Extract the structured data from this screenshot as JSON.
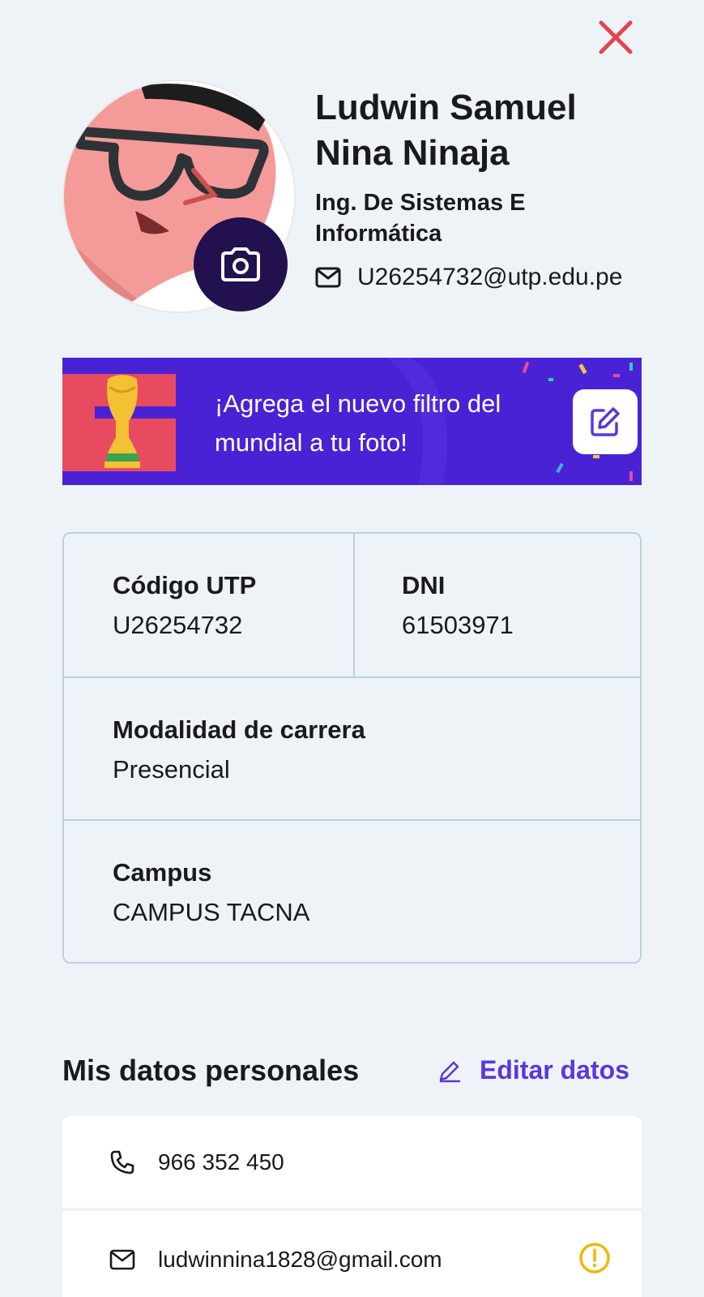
{
  "profile": {
    "name_line1": "Ludwin Samuel",
    "name_line2": "Nina Ninaja",
    "career_line1": "Ing. De Sistemas E",
    "career_line2": "Informática",
    "email": "U26254732@utp.edu.pe"
  },
  "banner": {
    "text_line1": "¡Agrega el nuevo filtro del",
    "text_line2": "mundial a tu foto!"
  },
  "info": {
    "codigo_label": "Código UTP",
    "codigo_value": "U26254732",
    "dni_label": "DNI",
    "dni_value": "61503971",
    "modalidad_label": "Modalidad de carrera",
    "modalidad_value": "Presencial",
    "campus_label": "Campus",
    "campus_value": "CAMPUS TACNA"
  },
  "personal": {
    "title": "Mis datos personales",
    "edit_label": "Editar datos",
    "phone": "966 352 450",
    "personal_email": "ludwinnina1828@gmail.com"
  },
  "icons": {
    "close": "close-icon",
    "camera": "camera-icon",
    "mail": "mail-icon",
    "edit": "edit-icon",
    "pencil": "pencil-icon",
    "phone": "phone-icon",
    "warning": "warning-icon",
    "trophy": "trophy-icon"
  },
  "colors": {
    "accent": "#5b36e0",
    "banner_bg": "#4a22d6",
    "close": "#e8424f",
    "camera_bg": "#23104f",
    "warning": "#f2b705"
  }
}
